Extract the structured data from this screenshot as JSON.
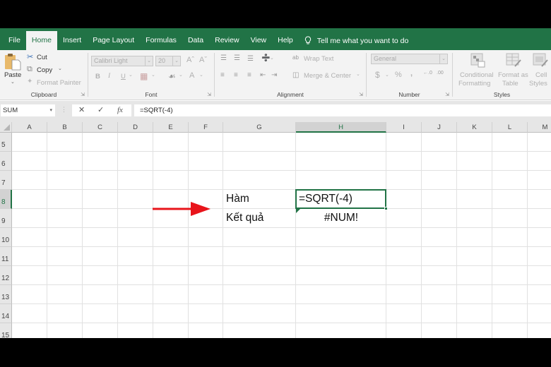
{
  "tabs": [
    {
      "label": "File",
      "active": false
    },
    {
      "label": "Home",
      "active": true
    },
    {
      "label": "Insert",
      "active": false
    },
    {
      "label": "Page Layout",
      "active": false
    },
    {
      "label": "Formulas",
      "active": false
    },
    {
      "label": "Data",
      "active": false
    },
    {
      "label": "Review",
      "active": false
    },
    {
      "label": "View",
      "active": false
    },
    {
      "label": "Help",
      "active": false
    }
  ],
  "tell_me": "Tell me what you want to do",
  "ribbon": {
    "clipboard": {
      "paste": "Paste",
      "cut": "Cut",
      "copy": "Copy",
      "format_painter": "Format Painter",
      "label": "Clipboard"
    },
    "font": {
      "font_name": "Calibri Light",
      "font_size": "20",
      "bold": "B",
      "italic": "I",
      "underline": "U",
      "font_color": "A",
      "grow": "Aˆ",
      "shrink": "Aˇ",
      "label": "Font"
    },
    "alignment": {
      "wrap_text": "Wrap Text",
      "merge_center": "Merge & Center",
      "label": "Alignment"
    },
    "number": {
      "format": "General",
      "currency": "$",
      "percent": "%",
      "comma": ",",
      "label": "Number"
    },
    "styles": {
      "conditional_1": "Conditional",
      "conditional_2": "Formatting",
      "format_table_1": "Format as",
      "format_table_2": "Table",
      "cell_styles_1": "Cell",
      "cell_styles_2": "Styles",
      "label": "Styles"
    }
  },
  "formula_bar": {
    "name_box": "SUM",
    "cancel": "✕",
    "enter": "✓",
    "fx": "fx",
    "formula": "=SQRT(-4)"
  },
  "columns": [
    "A",
    "B",
    "C",
    "D",
    "E",
    "F",
    "G",
    "H",
    "I",
    "J",
    "K",
    "L",
    "M"
  ],
  "selected_column": "H",
  "rows": [
    "5",
    "6",
    "7",
    "8",
    "9",
    "10",
    "11",
    "12",
    "13",
    "14",
    "15"
  ],
  "selected_row": "8",
  "cells": {
    "G8": "Hàm",
    "H8": "=SQRT(-4)",
    "G9": "Kết quả",
    "H9": "#NUM!"
  },
  "colors": {
    "excel_green": "#217346",
    "arrow_red": "#e8141b"
  }
}
